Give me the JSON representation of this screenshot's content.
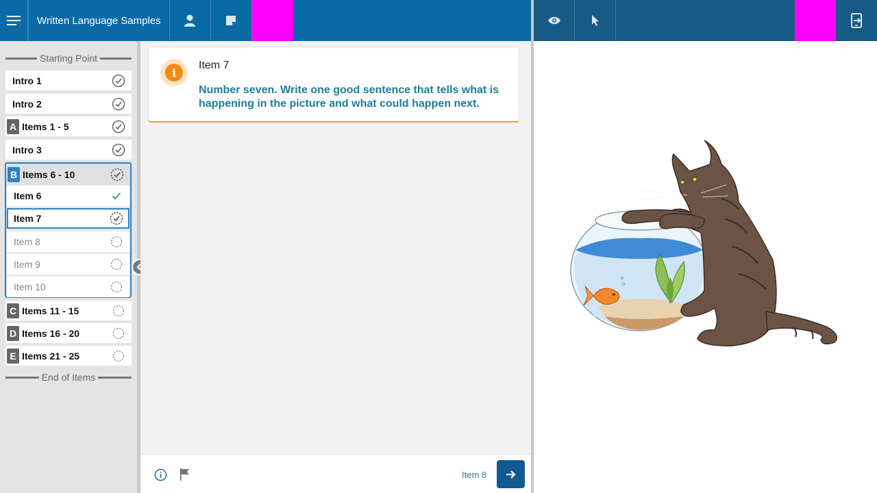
{
  "header": {
    "title": "Written Language Samples",
    "menu_icon": "hamburger-menu-icon",
    "person_icon": "person-icon",
    "note_icon": "sticky-note-icon",
    "eye_icon": "eye-icon",
    "pointer_icon": "pointer-icon",
    "exit_icon": "exit-icon"
  },
  "sidebar": {
    "start_label": "Starting Point",
    "end_label": "End of Items",
    "items": [
      {
        "label": "Intro 1",
        "status": "complete"
      },
      {
        "label": "Intro 2",
        "status": "complete"
      },
      {
        "letter": "A",
        "label": "Items 1 - 5",
        "status": "complete"
      },
      {
        "label": "Intro 3",
        "status": "complete"
      }
    ],
    "group_b": {
      "letter": "B",
      "label": "Items 6 - 10",
      "status": "in-progress",
      "children": [
        {
          "label": "Item 6",
          "status": "done"
        },
        {
          "label": "Item 7",
          "status": "current"
        },
        {
          "label": "Item 8",
          "status": "not-started"
        },
        {
          "label": "Item 9",
          "status": "not-started"
        },
        {
          "label": "Item 10",
          "status": "not-started"
        }
      ]
    },
    "later": [
      {
        "letter": "C",
        "label": "Items 11 - 15",
        "status": "not-started"
      },
      {
        "letter": "D",
        "label": "Items 16 - 20",
        "status": "not-started"
      },
      {
        "letter": "E",
        "label": "Items 21 - 25",
        "status": "not-started"
      }
    ]
  },
  "card": {
    "title": "Item 7",
    "text": "Number seven. Write one good sentence that tells what is happening in the picture and what could happen next."
  },
  "footer": {
    "next_label": "Item 8"
  },
  "colors": {
    "header_left": "#0a6aa6",
    "header_right": "#165a85",
    "accent": "#2a82c7",
    "instruction_text": "#1a7e97",
    "highlight_magenta": "#ff00ff"
  }
}
